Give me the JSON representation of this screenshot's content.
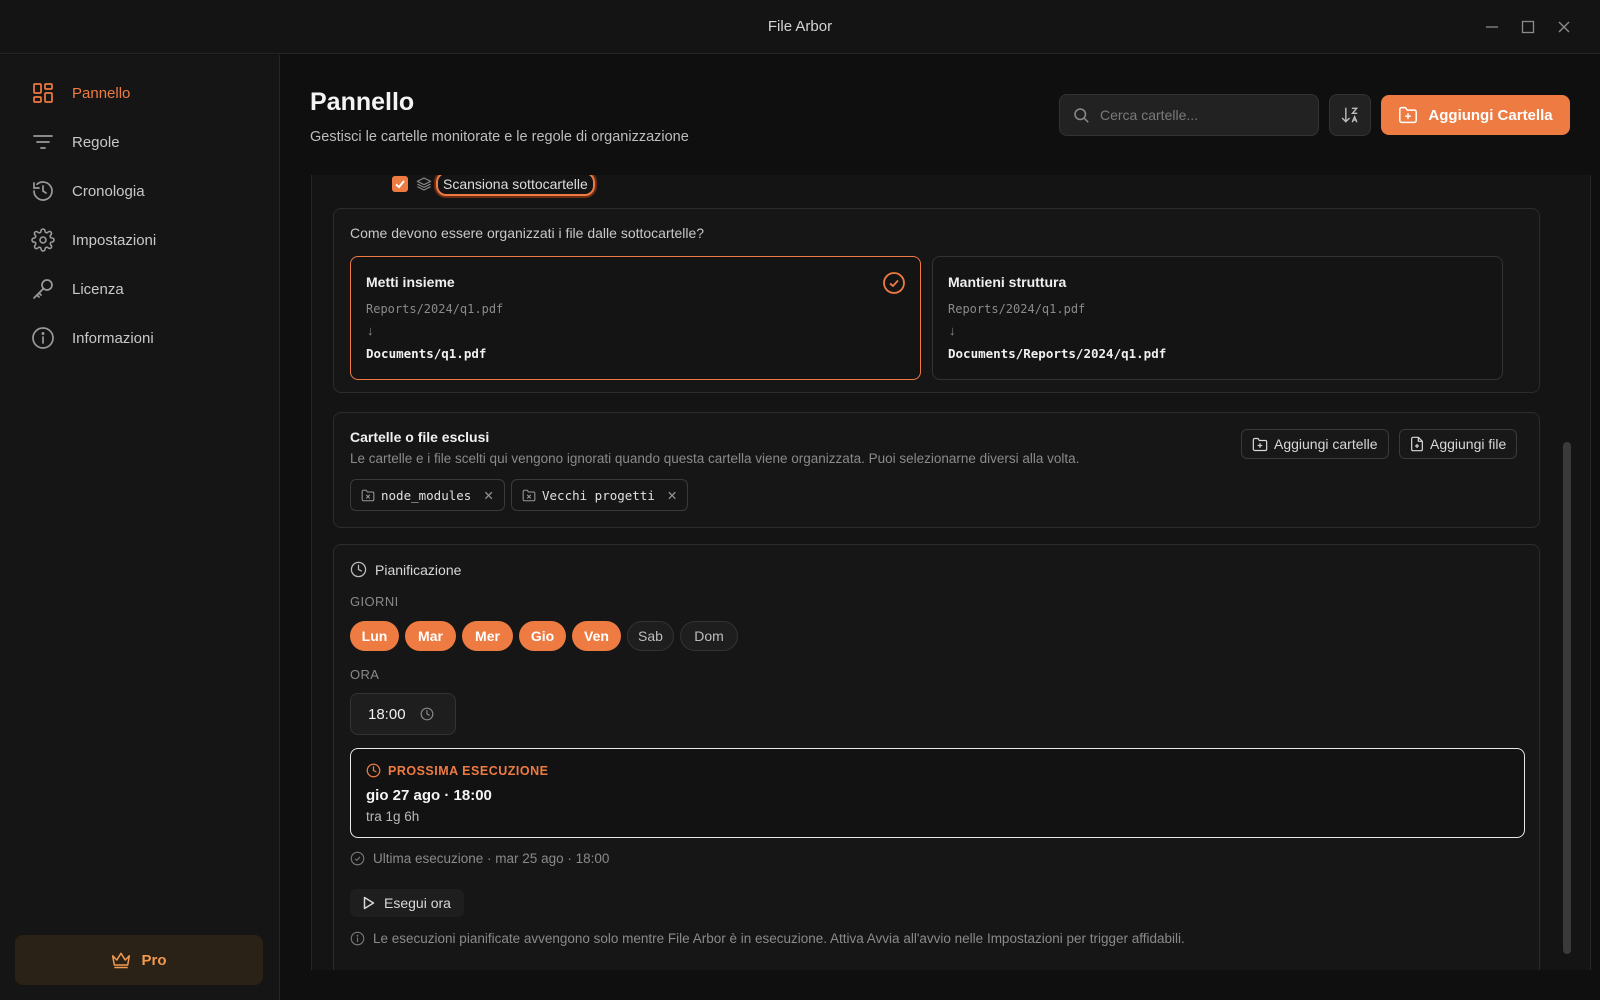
{
  "app": {
    "title": "File Arbor"
  },
  "sidebar": {
    "items": [
      {
        "label": "Pannello",
        "icon": "dashboard-icon"
      },
      {
        "label": "Regole",
        "icon": "filter-icon"
      },
      {
        "label": "Cronologia",
        "icon": "history-icon"
      },
      {
        "label": "Impostazioni",
        "icon": "gear-icon"
      },
      {
        "label": "Licenza",
        "icon": "key-icon"
      },
      {
        "label": "Informazioni",
        "icon": "info-icon"
      }
    ],
    "pro_label": "Pro"
  },
  "header": {
    "title": "Pannello",
    "subtitle": "Gestisci le cartelle monitorate e le regole di organizzazione",
    "search_placeholder": "Cerca cartelle...",
    "add_folder_label": "Aggiungi Cartella"
  },
  "subfolders": {
    "scan_label": "Scansiona sottocartelle",
    "question": "Come devono essere organizzati i file dalle sottocartelle?",
    "options": [
      {
        "title": "Metti insieme",
        "src": "Reports/2024/q1.pdf",
        "arrow": "↓",
        "dst": "Documents/q1.pdf"
      },
      {
        "title": "Mantieni struttura",
        "src": "Reports/2024/q1.pdf",
        "arrow": "↓",
        "dst": "Documents/Reports/2024/q1.pdf"
      }
    ]
  },
  "excluded": {
    "title": "Cartelle o file esclusi",
    "description": "Le cartelle e i file scelti qui vengono ignorati quando questa cartella viene organizzata. Puoi selezionarne diversi alla volta.",
    "add_folders_label": "Aggiungi cartelle",
    "add_file_label": "Aggiungi file",
    "items": [
      "node_modules",
      "Vecchi progetti"
    ],
    "remove_glyph": "✕"
  },
  "schedule": {
    "title": "Pianificazione",
    "days_label": "GIORNI",
    "days": [
      {
        "label": "Lun",
        "on": true
      },
      {
        "label": "Mar",
        "on": true
      },
      {
        "label": "Mer",
        "on": true
      },
      {
        "label": "Gio",
        "on": true
      },
      {
        "label": "Ven",
        "on": true
      },
      {
        "label": "Sab",
        "on": false
      },
      {
        "label": "Dom",
        "on": false
      }
    ],
    "time_label": "ORA",
    "time_value": "18:00",
    "next_run_label": "PROSSIMA ESECUZIONE",
    "next_run_date": "gio 27 ago · 18:00",
    "next_run_relative": "tra 1g 6h",
    "last_run": "Ultima esecuzione · mar 25 ago · 18:00",
    "run_now_label": "Esegui ora",
    "note": "Le esecuzioni pianificate avvengono solo mentre File Arbor è in esecuzione. Attiva Avvia all'avvio nelle Impostazioni per trigger affidabili."
  },
  "colors": {
    "accent": "#ee7b42",
    "background": "#0f0f0f",
    "panel": "#161616"
  }
}
